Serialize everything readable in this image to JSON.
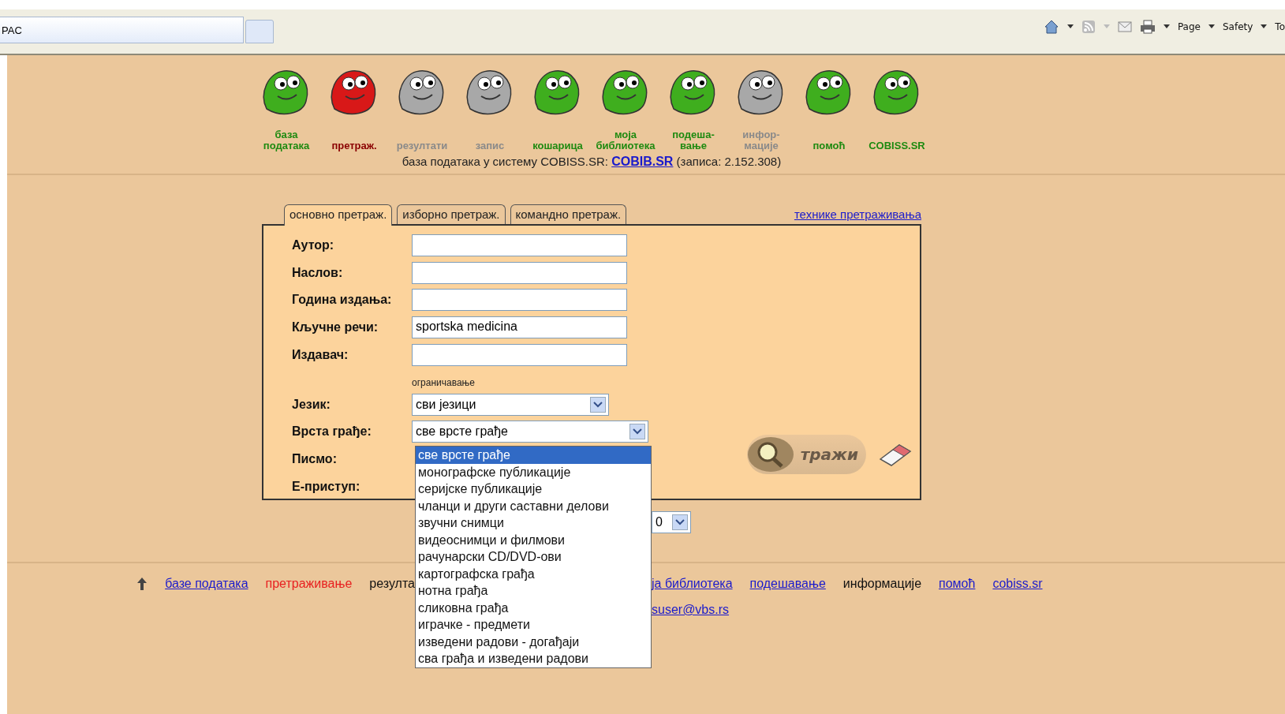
{
  "browser": {
    "tab_title": "PAC",
    "toolbar": [
      "Page",
      "Safety",
      "To"
    ]
  },
  "nav_icons": [
    {
      "label": "база\nподатака",
      "kind": "enabled"
    },
    {
      "label": "претраж.",
      "kind": "current"
    },
    {
      "label": "резултати",
      "kind": "disabled"
    },
    {
      "label": "запис",
      "kind": "disabled"
    },
    {
      "label": "кошарица",
      "kind": "enabled"
    },
    {
      "label": "моја\nбиблиотека",
      "kind": "enabled"
    },
    {
      "label": "подеша-\nвање",
      "kind": "enabled"
    },
    {
      "label": "инфор-\nмације",
      "kind": "disabled"
    },
    {
      "label": "помоћ",
      "kind": "enabled"
    },
    {
      "label": "COBISS.SR",
      "kind": "enabled"
    }
  ],
  "database_line": {
    "prefix": "база података у систему COBISS.SR:",
    "link": "COBIB.SR",
    "suffix": "(записа: 2.152.308)"
  },
  "tabs": [
    {
      "label": "основно претраж.",
      "selected": true
    },
    {
      "label": "изборно претраж.",
      "selected": false
    },
    {
      "label": "командно претраж.",
      "selected": false
    }
  ],
  "help_link": "технике претраживања",
  "fields": [
    {
      "label": "Аутор:"
    },
    {
      "label": "Наслов:"
    },
    {
      "label": "Година издања:"
    },
    {
      "label": "Кључне речи:",
      "value": "sportska medicina"
    },
    {
      "label": "Издавач:"
    }
  ],
  "limits_caption": "ограничавање",
  "limits": [
    {
      "label": "Језик:",
      "value": "сви језици"
    },
    {
      "label": "Врста грађе:",
      "value": "све врсте грађе",
      "expanded": true
    },
    {
      "label": "Писмо:"
    },
    {
      "label": "Е-приступ:"
    }
  ],
  "dropdown_options": [
    {
      "label": "све врсте грађе",
      "selected": true
    },
    {
      "label": "монографске публикације",
      "selected": false
    },
    {
      "label": "серијске публикације",
      "selected": false
    },
    {
      "label": "чланци и други саставни делови",
      "selected": false
    },
    {
      "label": "звучни снимци",
      "selected": false
    },
    {
      "label": "видеоснимци и филмови",
      "selected": false
    },
    {
      "label": "рачунарски CD/DVD-ови",
      "selected": false
    },
    {
      "label": "картографска грађа",
      "selected": false
    },
    {
      "label": "нотна грађа",
      "selected": false
    },
    {
      "label": "сликовна грађа",
      "selected": false
    },
    {
      "label": "играчке - предмети",
      "selected": false
    },
    {
      "label": "изведени радови - догађаји",
      "selected": false
    },
    {
      "label": "сва грађа и изведени радови",
      "selected": false
    }
  ],
  "search_button": "тражи",
  "results_select": "0",
  "footer_left": [
    {
      "label": "базе података",
      "kind": "link"
    },
    {
      "label": "претраживање",
      "kind": "current"
    },
    {
      "label": "резулта",
      "kind": "plain"
    }
  ],
  "footer_right": [
    {
      "label": "ја библиотека",
      "kind": "link"
    },
    {
      "label": "подешавање",
      "kind": "link"
    },
    {
      "label": "информације",
      "kind": "plain"
    },
    {
      "label": "помоћ",
      "kind": "link"
    },
    {
      "label": "cobiss.sr",
      "kind": "link"
    }
  ],
  "email": "suser@vbs.rs"
}
